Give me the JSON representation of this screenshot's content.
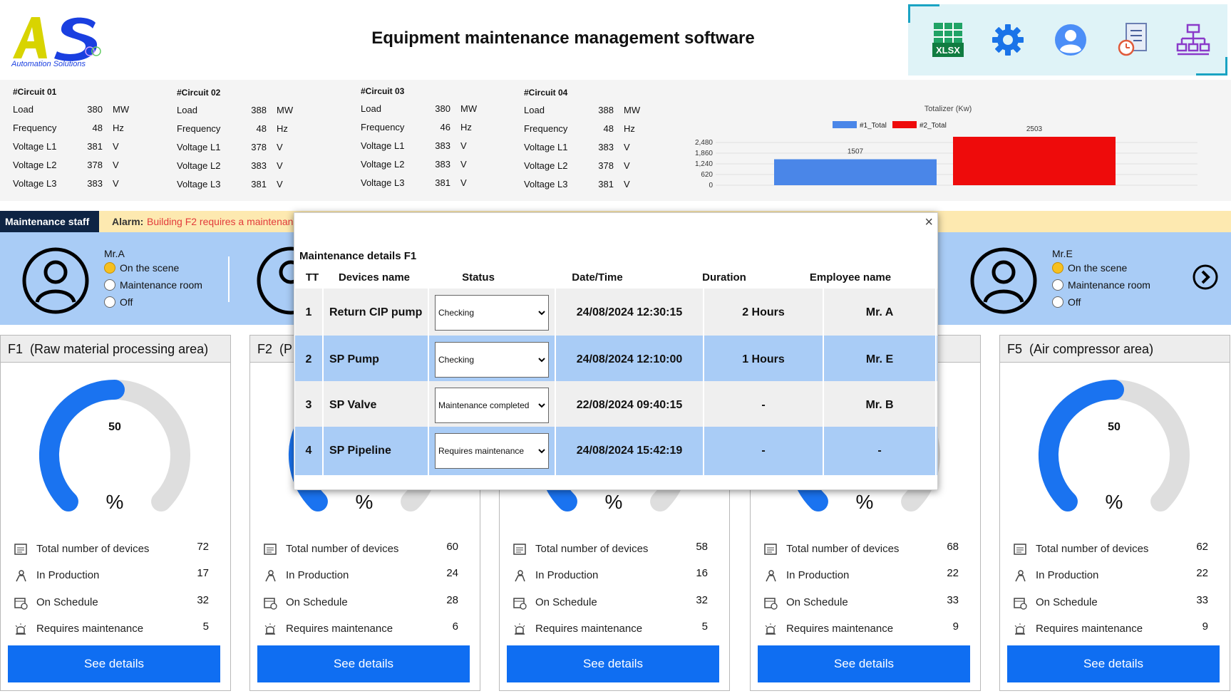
{
  "header": {
    "logo_text": "AS",
    "logo_subtitle": "Automation Solutions",
    "title": "Equipment maintenance management software",
    "toolbar": [
      {
        "icon": "excel-xlsx-icon",
        "label": "XLSX"
      },
      {
        "icon": "gear-icon"
      },
      {
        "icon": "user-icon"
      },
      {
        "icon": "report-clock-icon"
      },
      {
        "icon": "network-hierarchy-icon"
      }
    ]
  },
  "circuits": [
    {
      "title": "#Circuit 01",
      "rows": [
        {
          "label": "Load",
          "value": "380",
          "unit": "MW"
        },
        {
          "label": "Frequency",
          "value": "48",
          "unit": "Hz"
        },
        {
          "label": "Voltage L1",
          "value": "381",
          "unit": "V"
        },
        {
          "label": "Voltage L2",
          "value": "378",
          "unit": "V"
        },
        {
          "label": "Voltage L3",
          "value": "383",
          "unit": "V"
        }
      ]
    },
    {
      "title": "#Circuit 02",
      "rows": [
        {
          "label": "Load",
          "value": "388",
          "unit": "MW"
        },
        {
          "label": "Frequency",
          "value": "48",
          "unit": "Hz"
        },
        {
          "label": "Voltage L1",
          "value": "378",
          "unit": "V"
        },
        {
          "label": "Voltage L2",
          "value": "383",
          "unit": "V"
        },
        {
          "label": "Voltage L3",
          "value": "381",
          "unit": "V"
        }
      ]
    },
    {
      "title": "#Circuit 03",
      "rows": [
        {
          "label": "Load",
          "value": "380",
          "unit": "MW"
        },
        {
          "label": "Frequency",
          "value": "46",
          "unit": "Hz"
        },
        {
          "label": "Voltage L1",
          "value": "383",
          "unit": "V"
        },
        {
          "label": "Voltage L2",
          "value": "383",
          "unit": "V"
        },
        {
          "label": "Voltage L3",
          "value": "381",
          "unit": "V"
        }
      ]
    },
    {
      "title": "#Circuit 04",
      "rows": [
        {
          "label": "Load",
          "value": "388",
          "unit": "MW"
        },
        {
          "label": "Frequency",
          "value": "48",
          "unit": "Hz"
        },
        {
          "label": "Voltage L1",
          "value": "383",
          "unit": "V"
        },
        {
          "label": "Voltage L2",
          "value": "378",
          "unit": "V"
        },
        {
          "label": "Voltage L3",
          "value": "381",
          "unit": "V"
        }
      ]
    }
  ],
  "chart_data": {
    "type": "bar",
    "title": "Totalizer (Kw)",
    "series": [
      {
        "name": "#1_Total",
        "values": [
          1507
        ],
        "color": "#4a86e8"
      },
      {
        "name": "#2_Total",
        "values": [
          2503
        ],
        "color": "#ee0b0b"
      }
    ],
    "y_ticks": [
      "0",
      "620",
      "1,240",
      "1,860",
      "2,480"
    ],
    "ylim": [
      0,
      2480
    ],
    "legend": "top",
    "grid": true
  },
  "alarm": {
    "tab_label": "Maintenance staff",
    "label": "Alarm:",
    "text": "Building F2 requires a maintenan"
  },
  "staff": [
    {
      "name": "Mr.A",
      "options": [
        "On the scene",
        "Maintenance room",
        "Off"
      ],
      "selected": 0
    },
    {
      "name": "Mr.E",
      "options": [
        "On the scene",
        "Maintenance room",
        "Off"
      ],
      "selected": 0
    }
  ],
  "areas": [
    {
      "code": "F1",
      "name": "(Raw material processing area)",
      "gauge_value": "50",
      "gauge_fraction": 0.5,
      "unit": "%",
      "stats": [
        {
          "label": "Total number of devices",
          "value": "72",
          "icon": "devices-list-icon"
        },
        {
          "label": "In Production",
          "value": "17",
          "icon": "production-icon"
        },
        {
          "label": "On Schedule",
          "value": "32",
          "icon": "calendar-schedule-icon"
        },
        {
          "label": "Requires maintenance",
          "value": "5",
          "icon": "alarm-maintenance-icon"
        }
      ],
      "button": "See details"
    },
    {
      "code": "F2",
      "name": "(P",
      "gauge_value": "",
      "gauge_fraction": 0.5,
      "unit": "%",
      "stats": [
        {
          "label": "Total number of devices",
          "value": "60",
          "icon": "devices-list-icon"
        },
        {
          "label": "In Production",
          "value": "24",
          "icon": "production-icon"
        },
        {
          "label": "On Schedule",
          "value": "28",
          "icon": "calendar-schedule-icon"
        },
        {
          "label": "Requires maintenance",
          "value": "6",
          "icon": "alarm-maintenance-icon"
        }
      ],
      "button": "See details"
    },
    {
      "code": "",
      "name": "",
      "gauge_value": "",
      "gauge_fraction": 0.5,
      "unit": "%",
      "stats": [
        {
          "label": "Total number of devices",
          "value": "58",
          "icon": "devices-list-icon"
        },
        {
          "label": "In Production",
          "value": "16",
          "icon": "production-icon"
        },
        {
          "label": "On Schedule",
          "value": "32",
          "icon": "calendar-schedule-icon"
        },
        {
          "label": "Requires maintenance",
          "value": "5",
          "icon": "alarm-maintenance-icon"
        }
      ],
      "button": "See details"
    },
    {
      "code": "",
      "name": "a)",
      "gauge_value": "",
      "gauge_fraction": 0.5,
      "unit": "%",
      "stats": [
        {
          "label": "Total number of devices",
          "value": "68",
          "icon": "devices-list-icon"
        },
        {
          "label": "In Production",
          "value": "22",
          "icon": "production-icon"
        },
        {
          "label": "On Schedule",
          "value": "33",
          "icon": "calendar-schedule-icon"
        },
        {
          "label": "Requires maintenance",
          "value": "9",
          "icon": "alarm-maintenance-icon"
        }
      ],
      "button": "See details"
    },
    {
      "code": "F5",
      "name": "(Air compressor area)",
      "gauge_value": "50",
      "gauge_fraction": 0.5,
      "unit": "%",
      "stats": [
        {
          "label": "Total number of devices",
          "value": "62",
          "icon": "devices-list-icon"
        },
        {
          "label": "In Production",
          "value": "22",
          "icon": "production-icon"
        },
        {
          "label": "On Schedule",
          "value": "33",
          "icon": "calendar-schedule-icon"
        },
        {
          "label": "Requires maintenance",
          "value": "9",
          "icon": "alarm-maintenance-icon"
        }
      ],
      "button": "See details"
    }
  ],
  "modal": {
    "title": "Maintenance details F1",
    "close": "×",
    "columns": [
      "TT",
      "Devices name",
      "Status",
      "Date/Time",
      "Duration",
      "Employee name"
    ],
    "rows": [
      {
        "tt": "1",
        "device": "Return CIP pump",
        "status": "Checking",
        "datetime": "24/08/2024 12:30:15",
        "duration": "2 Hours",
        "employee": "Mr. A"
      },
      {
        "tt": "2",
        "device": "SP Pump",
        "status": "Checking",
        "datetime": "24/08/2024 12:10:00",
        "duration": "1 Hours",
        "employee": "Mr. E"
      },
      {
        "tt": "3",
        "device": "SP Valve",
        "status": "Maintenance completed",
        "datetime": "22/08/2024 09:40:15",
        "duration": "-",
        "employee": "Mr. B"
      },
      {
        "tt": "4",
        "device": "SP Pipeline",
        "status": "Requires maintenance",
        "datetime": "24/08/2024 15:42:19",
        "duration": "-",
        "employee": "-"
      }
    ]
  }
}
